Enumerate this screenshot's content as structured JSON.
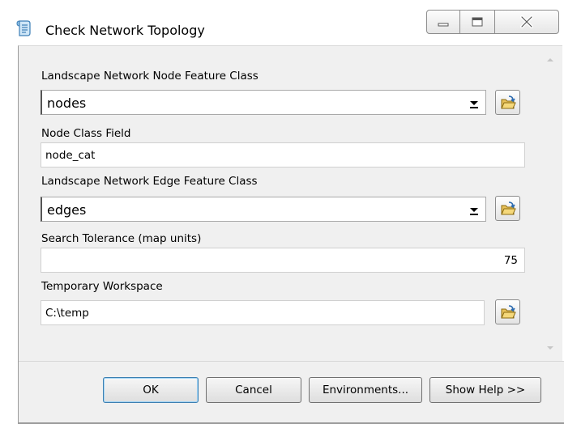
{
  "window": {
    "title": "Check Network Topology"
  },
  "fields": {
    "node_fc": {
      "label": "Landscape Network Node Feature Class",
      "value": "nodes"
    },
    "node_class_field": {
      "label": "Node Class Field",
      "value": "node_cat"
    },
    "edge_fc": {
      "label": "Landscape Network Edge Feature Class",
      "value": "edges"
    },
    "search_tolerance": {
      "label": "Search Tolerance (map units)",
      "value": "75"
    },
    "temp_workspace": {
      "label": "Temporary Workspace",
      "value": "C:\\temp"
    }
  },
  "buttons": {
    "ok": "OK",
    "cancel": "Cancel",
    "environments": "Environments...",
    "show_help": "Show Help >>"
  },
  "icons": {
    "app": "script-tool-icon",
    "browse": "open-folder-icon",
    "dropdown": "dropdown-arrow-icon"
  },
  "colors": {
    "panel_background": "#f0f0f0",
    "ok_button_border": "#3c7fb1",
    "folder_icon": "#e8c15a"
  }
}
